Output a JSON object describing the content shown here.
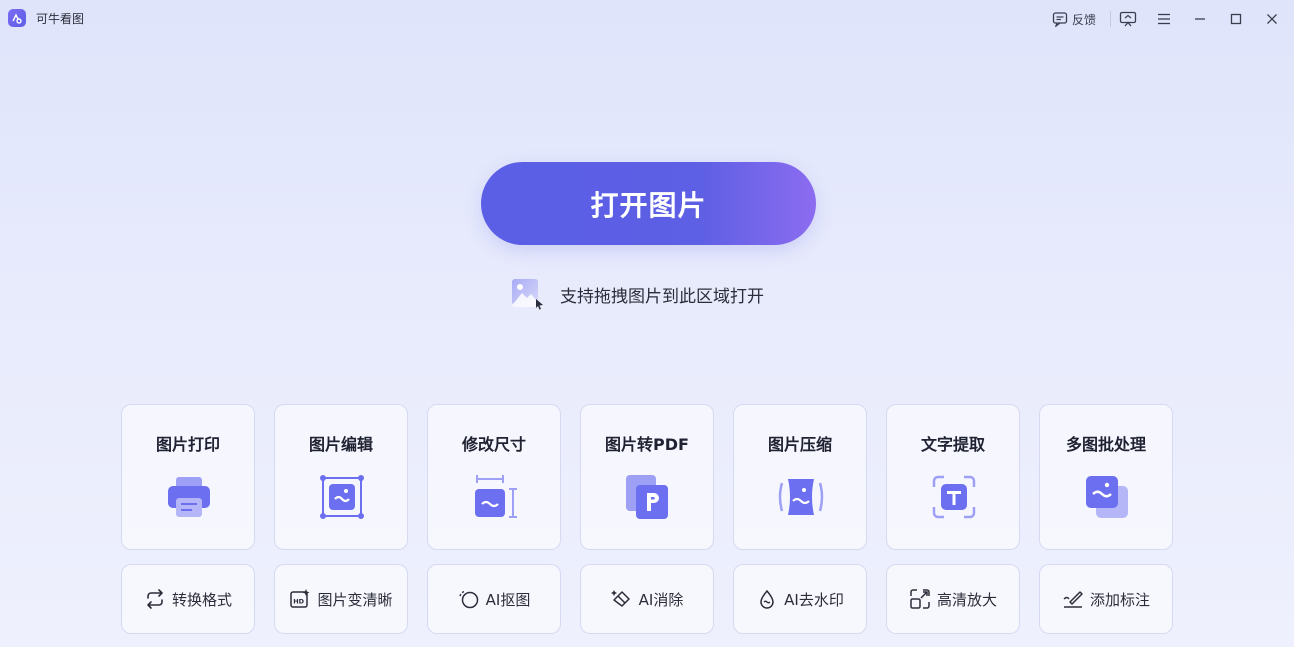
{
  "app": {
    "title": "可牛看图"
  },
  "titlebar": {
    "feedback_label": "反馈"
  },
  "main": {
    "open_button_label": "打开图片",
    "drop_hint": "支持拖拽图片到此区域打开"
  },
  "cards": [
    {
      "label": "图片打印",
      "icon": "printer-icon"
    },
    {
      "label": "图片编辑",
      "icon": "image-edit-icon"
    },
    {
      "label": "修改尺寸",
      "icon": "resize-icon"
    },
    {
      "label": "图片转PDF",
      "icon": "pdf-icon"
    },
    {
      "label": "图片压缩",
      "icon": "compress-icon"
    },
    {
      "label": "文字提取",
      "icon": "text-extract-icon"
    },
    {
      "label": "多图批处理",
      "icon": "batch-icon"
    }
  ],
  "tools": [
    {
      "label": "转换格式",
      "icon": "convert-icon"
    },
    {
      "label": "图片变清晰",
      "icon": "hd-icon"
    },
    {
      "label": "AI抠图",
      "icon": "cutout-icon"
    },
    {
      "label": "AI消除",
      "icon": "eraser-icon"
    },
    {
      "label": "AI去水印",
      "icon": "watermark-remove-icon"
    },
    {
      "label": "高清放大",
      "icon": "enlarge-icon"
    },
    {
      "label": "添加标注",
      "icon": "annotate-icon"
    }
  ],
  "colors": {
    "accent": "#5a5fe6",
    "accent_end": "#8c6cf0",
    "icon_fill": "#6b6ff0",
    "icon_light": "#b4b6f7"
  }
}
